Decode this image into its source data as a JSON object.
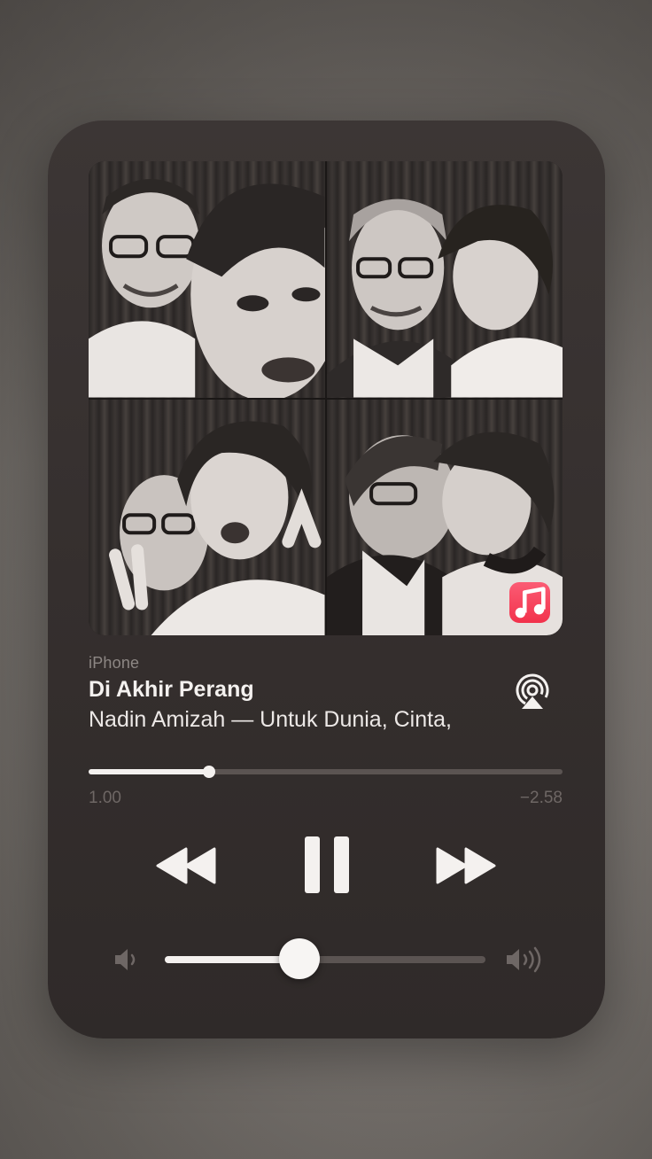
{
  "player": {
    "source": "iPhone",
    "title": "Di Akhir Perang",
    "artist_album": "Nadin Amizah — Untuk Dunia, Cinta,",
    "elapsed": "1.00",
    "remaining": "−2.58",
    "progress": 0.254,
    "volume": 0.42,
    "is_playing": true
  },
  "artwork": {
    "description_icon": "photo-booth-strip",
    "badge_icon": "apple-music-icon"
  },
  "controls": {
    "rewind_icon": "rewind-icon",
    "pause_icon": "pause-icon",
    "forward_icon": "fast-forward-icon",
    "airplay_icon": "airplay-icon",
    "volume_low_icon": "volume-low-icon",
    "volume_high_icon": "volume-high-icon"
  },
  "colors": {
    "card_bg": "#352f2e",
    "accent_white": "#f4f1ef",
    "track_gray": "#5b5452",
    "muted_text": "#8d8784",
    "music_badge": "#f2324c"
  }
}
